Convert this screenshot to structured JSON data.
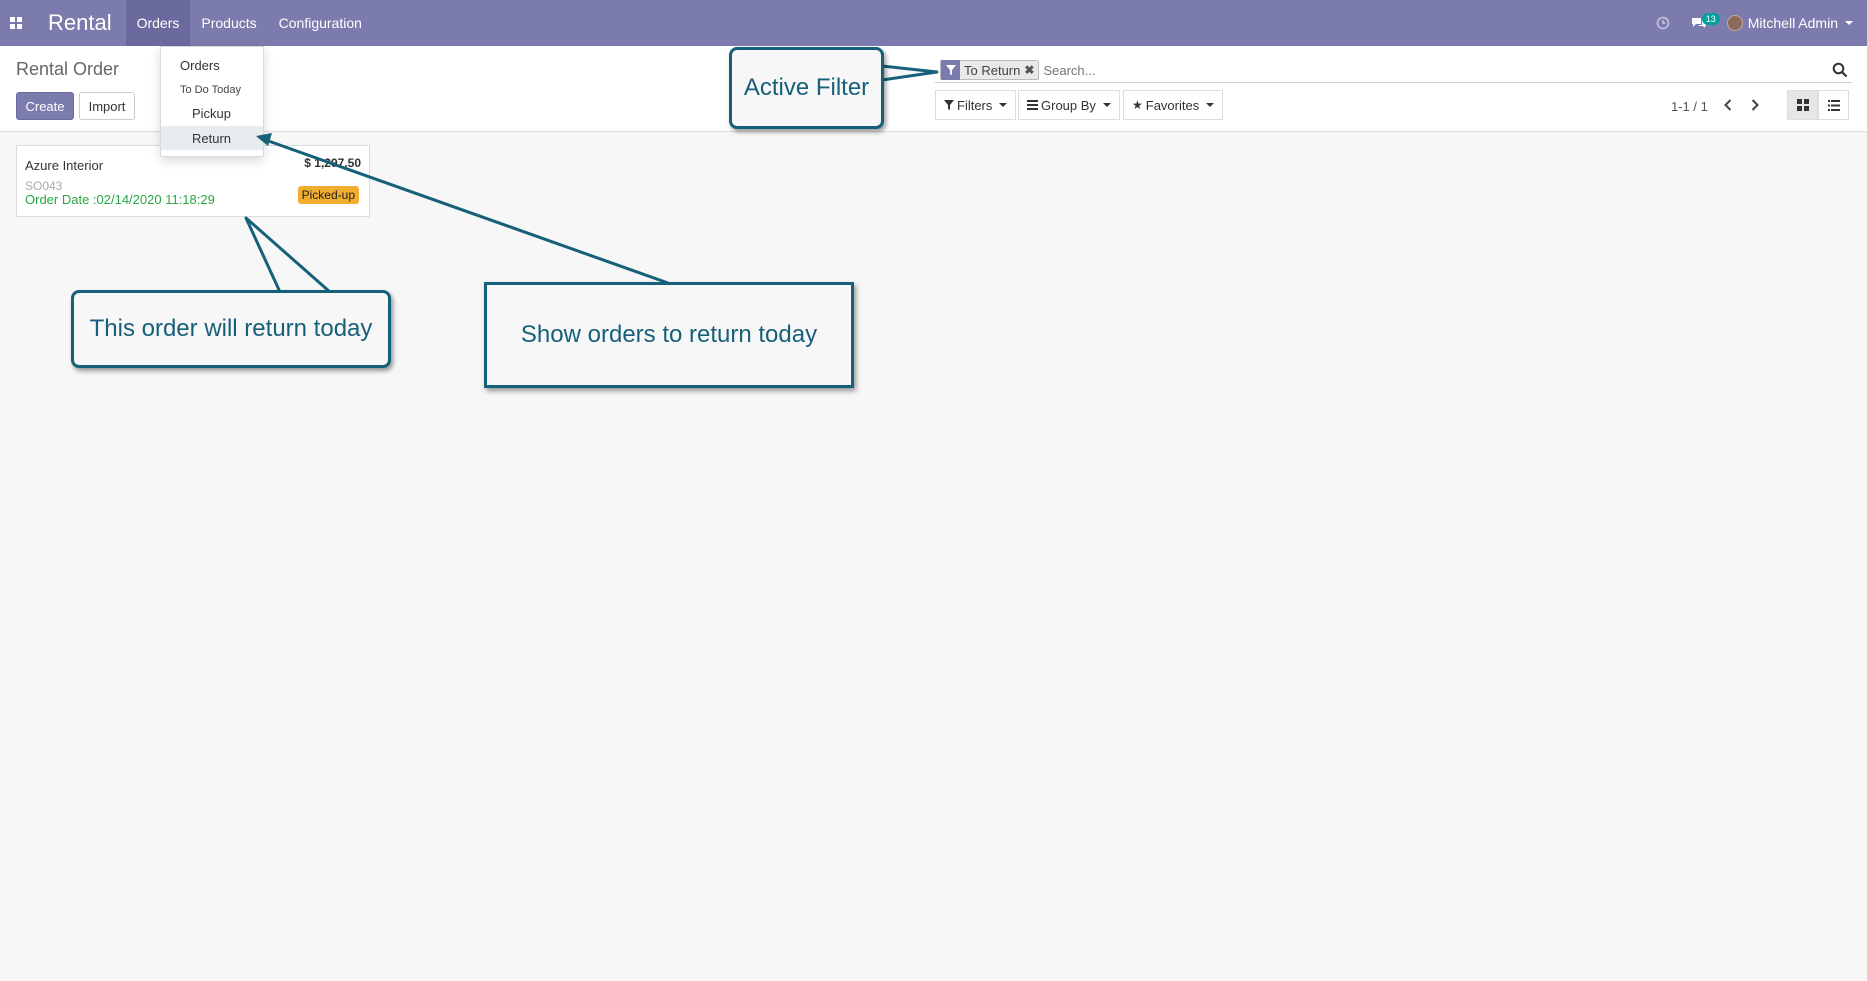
{
  "navbar": {
    "app_name": "Rental",
    "menus": [
      "Orders",
      "Products",
      "Configuration"
    ],
    "messages_count": "13",
    "user_name": "Mitchell Admin",
    "color": "#7c7bad"
  },
  "orders_menu": {
    "items": [
      "Orders",
      "To Do Today",
      "Pickup",
      "Return"
    ]
  },
  "control_panel": {
    "title": "Rental Order",
    "create_label": "Create",
    "import_label": "Import",
    "search": {
      "facet": "To Return",
      "placeholder": "Search..."
    },
    "filters_label": "Filters",
    "group_by_label": "Group By",
    "favorites_label": "Favorites",
    "pager": "1-1 / 1"
  },
  "orders": [
    {
      "customer": "Azure Interior",
      "amount": "$ 1,297.50",
      "reference": "SO043",
      "order_date": "Order Date :02/14/2020 11:18:29",
      "status": "Picked-up"
    }
  ],
  "annotations": {
    "active_filter": "Active Filter",
    "order_return": "This order will return today",
    "show_orders": "Show orders to return today"
  }
}
